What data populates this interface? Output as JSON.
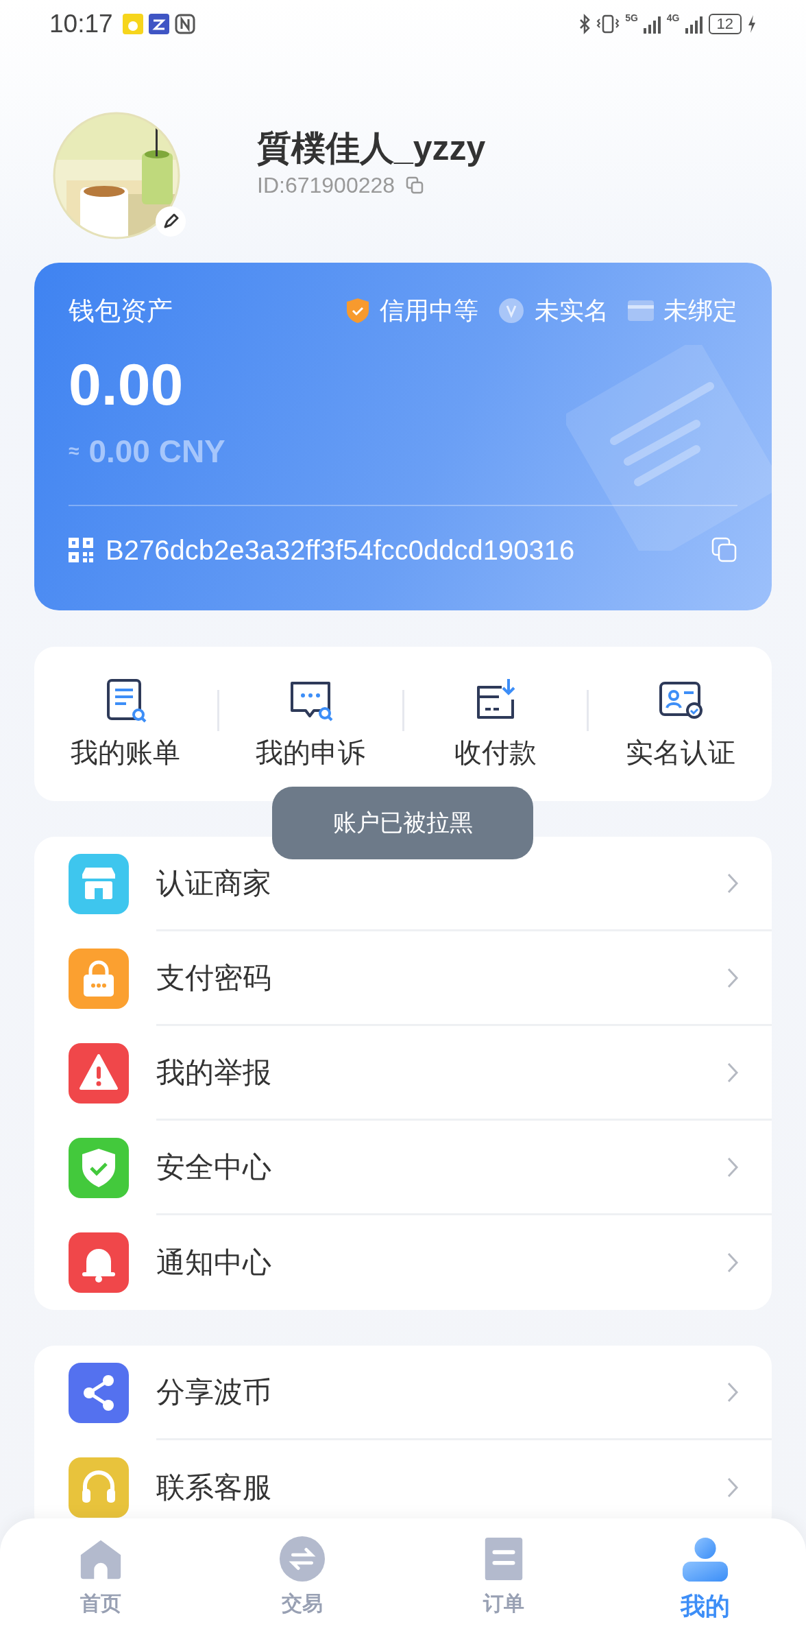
{
  "status_bar": {
    "time": "10:17",
    "network_1": "5G",
    "network_2": "4G",
    "battery": "12"
  },
  "profile": {
    "name": "質樸佳人_yzzy",
    "id": "ID:671900228"
  },
  "wallet": {
    "title": "钱包资产",
    "badges": [
      {
        "kind": "credit",
        "label": "信用中等"
      },
      {
        "kind": "verify",
        "label": "未实名"
      },
      {
        "kind": "card",
        "label": "未绑定"
      }
    ],
    "balance": "0.00",
    "approx_sign": "≈",
    "approx": "0.00 CNY",
    "address": "B276dcb2e3a32ff3f54fcc0ddcd190316"
  },
  "actions": [
    {
      "kind": "bill",
      "label": "我的账单"
    },
    {
      "kind": "appeal",
      "label": "我的申诉"
    },
    {
      "kind": "payment",
      "label": "收付款"
    },
    {
      "kind": "identity",
      "label": "实名认证"
    }
  ],
  "toast": "账户已被拉黑",
  "menu_groups": [
    [
      {
        "kind": "store",
        "label": "认证商家",
        "color": "#3ec6ee"
      },
      {
        "kind": "lock",
        "label": "支付密码",
        "color": "#fba030"
      },
      {
        "kind": "warning",
        "label": "我的举报",
        "color": "#f0474a"
      },
      {
        "kind": "shield",
        "label": "安全中心",
        "color": "#43c93c"
      },
      {
        "kind": "bell",
        "label": "通知中心",
        "color": "#f0474a"
      }
    ],
    [
      {
        "kind": "share",
        "label": "分享波币",
        "color": "#5471ef"
      },
      {
        "kind": "headset",
        "label": "联系客服",
        "color": "#e8c33c"
      }
    ]
  ],
  "tabs": [
    {
      "kind": "home",
      "label": "首页",
      "selected": false
    },
    {
      "kind": "exchange",
      "label": "交易",
      "selected": false
    },
    {
      "kind": "order",
      "label": "订单",
      "selected": false
    },
    {
      "kind": "user",
      "label": "我的",
      "selected": true
    }
  ]
}
